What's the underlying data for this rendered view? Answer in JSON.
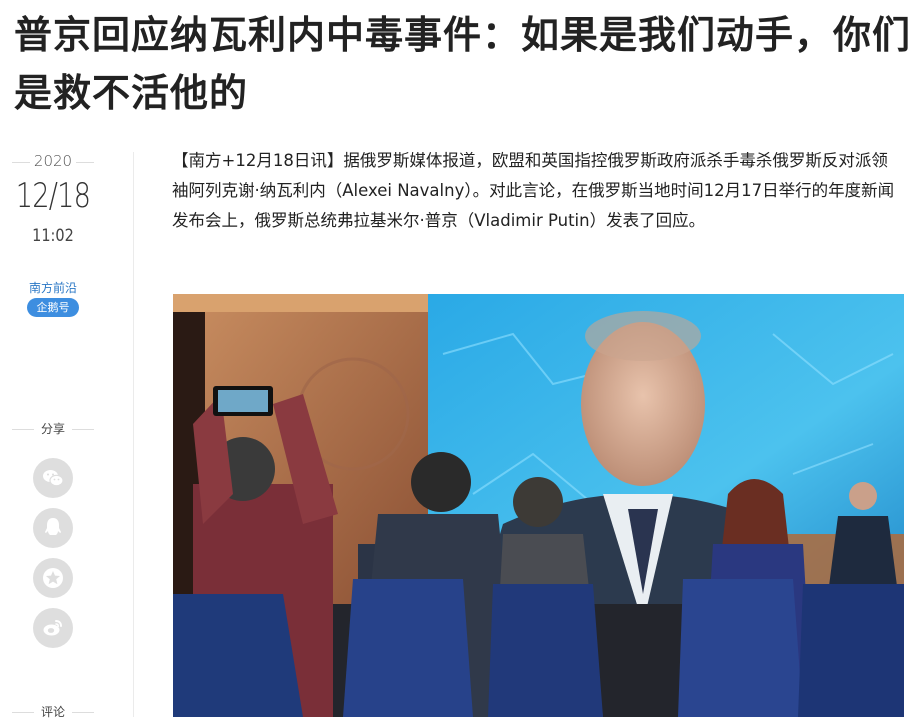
{
  "article": {
    "title": "普京回应纳瓦利内中毒事件：如果是我们动手，你们是救不活他的",
    "lead": "【南方+12月18日讯】据俄罗斯媒体报道，欧盟和英国指控俄罗斯政府派杀手毒杀俄罗斯反对派领袖阿列克谢·纳瓦利内（Alexei Navalny）。对此言论，在俄罗斯当地时间12月17日举行的年度新闻发布会上，俄罗斯总统弗拉基米尔·普京（Vladimir Putin）发表了回应。"
  },
  "meta": {
    "year": "2020",
    "date": "12/18",
    "time": "11:02",
    "source": "南方前沿",
    "badge": "企鹅号"
  },
  "share": {
    "label": "分享",
    "icons": [
      "wechat-icon",
      "qq-icon",
      "qzone-star-icon",
      "weibo-icon"
    ]
  },
  "comment": {
    "label": "评论"
  },
  "colors": {
    "accent": "#3d8ee0",
    "link": "#2b78c6",
    "icon_bg": "#dedede"
  }
}
